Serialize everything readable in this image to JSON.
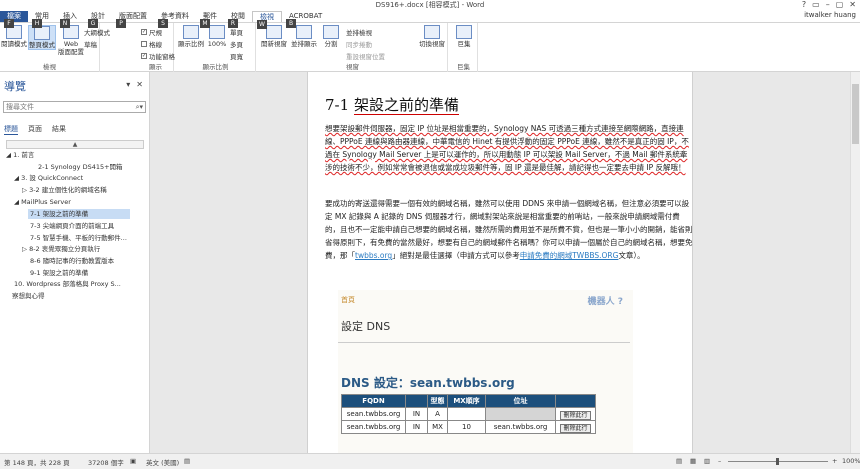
{
  "window": {
    "title": "DS916+.docx [相容模式] - Word",
    "controls": [
      "?",
      "▭",
      "–",
      "▢",
      "✕"
    ]
  },
  "tabs": [
    {
      "label": "檔案",
      "key": "F"
    },
    {
      "label": "常用",
      "key": "H"
    },
    {
      "label": "插入",
      "key": "N"
    },
    {
      "label": "設計",
      "key": "G"
    },
    {
      "label": "版面配置",
      "key": "P"
    },
    {
      "label": "參考資料",
      "key": "S"
    },
    {
      "label": "郵件",
      "key": "M"
    },
    {
      "label": "校閱",
      "key": "R"
    },
    {
      "label": "檢視",
      "key": "W"
    },
    {
      "label": "ACROBAT",
      "key": "B"
    }
  ],
  "user": "itwalker huang",
  "ribbon": {
    "views": {
      "read_mode": "閱讀模式",
      "print_layout": "整頁模式",
      "web_layout": "Web\n版面配置",
      "outline": "大綱模式",
      "draft": "草稿",
      "label": "檢視"
    },
    "show": {
      "ruler": "尺規",
      "gridlines": "格線",
      "nav_pane": "功能窗格",
      "label": "顯示"
    },
    "zoom": {
      "zoom": "顯示比例",
      "pct": "100%",
      "one_page": "單頁",
      "multi_page": "多頁",
      "page_width": "頁寬",
      "label": "顯示比例"
    },
    "window": {
      "new_window": "開新視窗",
      "arrange_all": "並排顯示",
      "split": "分割",
      "side_by_side": "並排檢視",
      "sync_scroll": "同步捲動",
      "reset_pos": "重設視窗位置",
      "switch": "切換視窗",
      "label": "視窗"
    },
    "macros": {
      "macros": "巨集",
      "label": "巨集"
    }
  },
  "nav": {
    "title": "導覽",
    "search_placeholder": "搜尋文件",
    "tabs": [
      "標題",
      "頁面",
      "結果"
    ],
    "headings": [
      "1. 前言",
      "2-1 Synology DS415+開箱",
      "3. 設 QuickConnect",
      "3-2 建立個性化的網域名稱",
      "MailPlus Server",
      "7-1 架設之前的準備",
      "7-3 尖端網頁介面的前端工具",
      "7-5 智慧手機、平板的行動郵件...",
      "8-2 衷覺眾獨立分頁執行",
      "8-6 隨時記事的行動教置版本",
      "9-1 架設之前的準備",
      "10. Wordpress 部落格與 Proxy S...",
      "察想與心得"
    ]
  },
  "doc": {
    "heading_num": "7-1",
    "heading_text": "架設之前的準備",
    "p1": "想要架設郵件伺服器，固定 IP 位址是相當重要的，Synology NAS 可透過三種方式連接至網際網路，直接連線、PPPoE 連線與路由器連線，中華電信的 Hinet 有提供浮動的固定 PPPoE 連線，雖然不是真正的固 IP，不過在 Synology Mail Server 上是可以運作的，所以用動態 IP 可以架設 Mail Server，不過 Mail 郵件系統牽涉的技術不少，例如常常會被退信或當成垃圾郵件等，固 IP 還是最佳解，請記得也一定要去申請 IP 反解哦！",
    "p2a": "要成功的寄送還得需要一個有效的網域名稱，雖然可以使用 DDNS 來申請一個網域名稱，但注意必須要可以設定 MX 記錄與 A 記錄的 DNS 伺服器才行，網域對架站來說是相當重要的前哨站，一般來說申請網域需付費的，且也不一定能申請自己想要的網域名稱，雖然所需的費用並不是所費不貲，但也是一筆小小的開銷，能省則省得原則下，有免費的當然最好，想要有自己的網域郵件名稱嗎？你可以申請一個屬於自己的網域名稱，想要免費，那「",
    "link1": "twbbs.org",
    "p2b": "」絕對是最佳選擇（申請方式可以參考",
    "link2": "申請免費的網域TWBBS.ORG",
    "p2c": "文章）。",
    "shot": {
      "crumb": "首頁",
      "watermark": "機器人 ?",
      "subtitle": "設定 DNS",
      "big": "DNS 設定：sean.twbbs.org",
      "cols": [
        "FQDN",
        "",
        "型態",
        "MX順序",
        "位址",
        ""
      ],
      "rows": [
        [
          "sean.twbbs.org",
          "IN",
          "A",
          "",
          "",
          "刪除此行"
        ],
        [
          "sean.twbbs.org",
          "IN",
          "MX",
          "10",
          "sean.twbbs.org",
          "刪除此行"
        ]
      ]
    }
  },
  "status": {
    "page": "第 148 頁，共 228 頁",
    "words": "37208 個字",
    "lang": "英文 (美國)",
    "zoom_pct": "100%"
  }
}
